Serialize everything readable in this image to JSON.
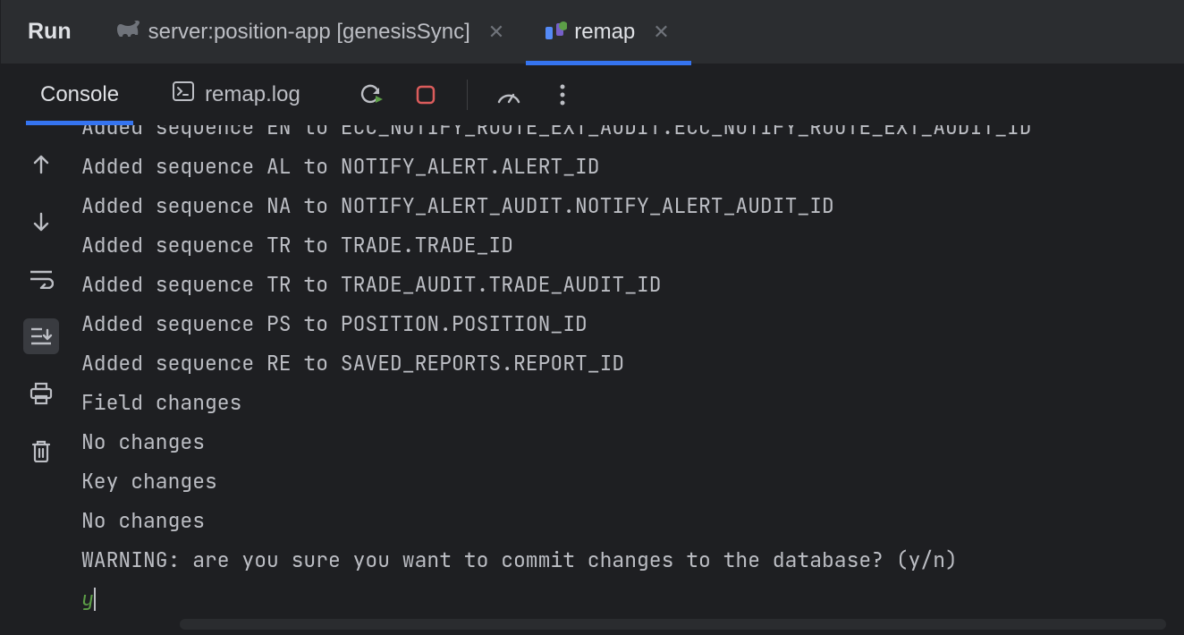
{
  "header": {
    "run_label": "Run",
    "tabs": [
      {
        "label": "server:position-app [genesisSync]",
        "active": false
      },
      {
        "label": "remap",
        "active": true
      }
    ]
  },
  "sub_tabs": {
    "console": "Console",
    "log_file": "remap.log"
  },
  "console": {
    "lines": [
      "Added sequence EN to ECC_NOTIFY_ROUTE_EXT_AUDIT.ECC_NOTIFY_ROUTE_EXT_AUDIT_ID",
      "Added sequence AL to NOTIFY_ALERT.ALERT_ID",
      "Added sequence NA to NOTIFY_ALERT_AUDIT.NOTIFY_ALERT_AUDIT_ID",
      "Added sequence TR to TRADE.TRADE_ID",
      "Added sequence TR to TRADE_AUDIT.TRADE_AUDIT_ID",
      "Added sequence PS to POSITION.POSITION_ID",
      "Added sequence RE to SAVED_REPORTS.REPORT_ID",
      "Field changes",
      "No changes",
      "Key changes",
      "No changes",
      "WARNING: are you sure you want to commit changes to the database? (y/n)"
    ],
    "input": "y"
  }
}
